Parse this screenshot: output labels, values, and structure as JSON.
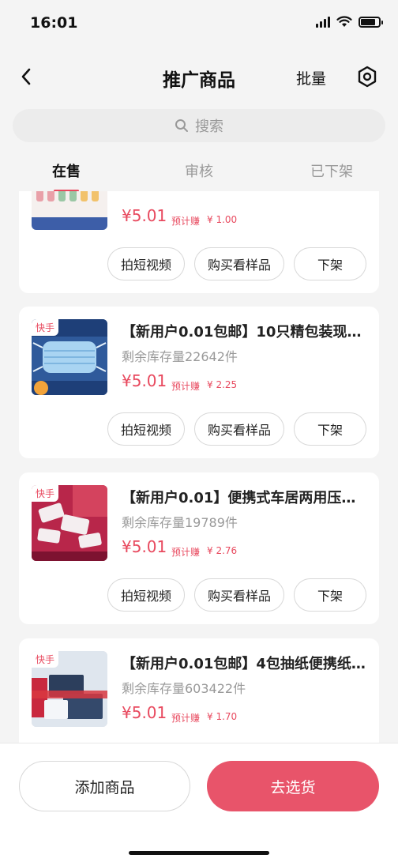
{
  "status_bar": {
    "time": "16:01"
  },
  "nav": {
    "title": "推广商品",
    "batch_label": "批量"
  },
  "search": {
    "placeholder": "搜索"
  },
  "tabs": [
    {
      "label": "在售",
      "active": true
    },
    {
      "label": "审核",
      "active": false
    },
    {
      "label": "已下架",
      "active": false
    }
  ],
  "labels": {
    "short_video": "拍短视频",
    "buy_sample": "购买看样品",
    "take_down": "下架",
    "expected_earn": "预计赚"
  },
  "products": [
    {
      "tag": "",
      "title": "",
      "stock": "",
      "price": "¥5.01",
      "earn": "¥ 1.00"
    },
    {
      "tag": "快手",
      "title": "【新用户0.01包邮】10只精包装现…",
      "stock": "剩余库存量22642件",
      "price": "¥5.01",
      "earn": "¥ 2.25"
    },
    {
      "tag": "快手",
      "title": "【新用户0.01】便携式车居两用压…",
      "stock": "剩余库存量19789件",
      "price": "¥5.01",
      "earn": "¥ 2.76"
    },
    {
      "tag": "快手",
      "title": "【新用户0.01包邮】4包抽纸便携纸…",
      "stock": "剩余库存量603422件",
      "price": "¥5.01",
      "earn": "¥ 1.70"
    }
  ],
  "bottom": {
    "add_label": "添加商品",
    "select_label": "去选货"
  },
  "colors": {
    "accent": "#e84a5f",
    "primary_button": "#e8546a",
    "background": "#f4f4f4"
  }
}
